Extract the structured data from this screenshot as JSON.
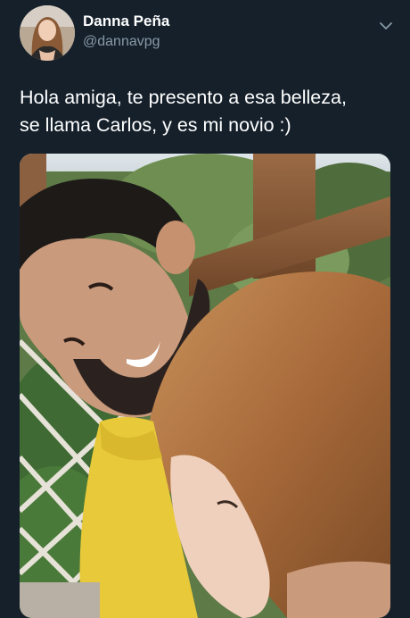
{
  "tweet": {
    "author": {
      "display_name": "Danna Peña",
      "handle": "@dannavpg"
    },
    "text_lines": [
      "Hola amiga, te presento a esa belleza,",
      "se llama Carlos, y es mi novio :)"
    ],
    "menu_icon": "chevron-down-icon"
  },
  "colors": {
    "background": "#15202b",
    "text": "#ffffff",
    "secondary_text": "#8899a6"
  }
}
